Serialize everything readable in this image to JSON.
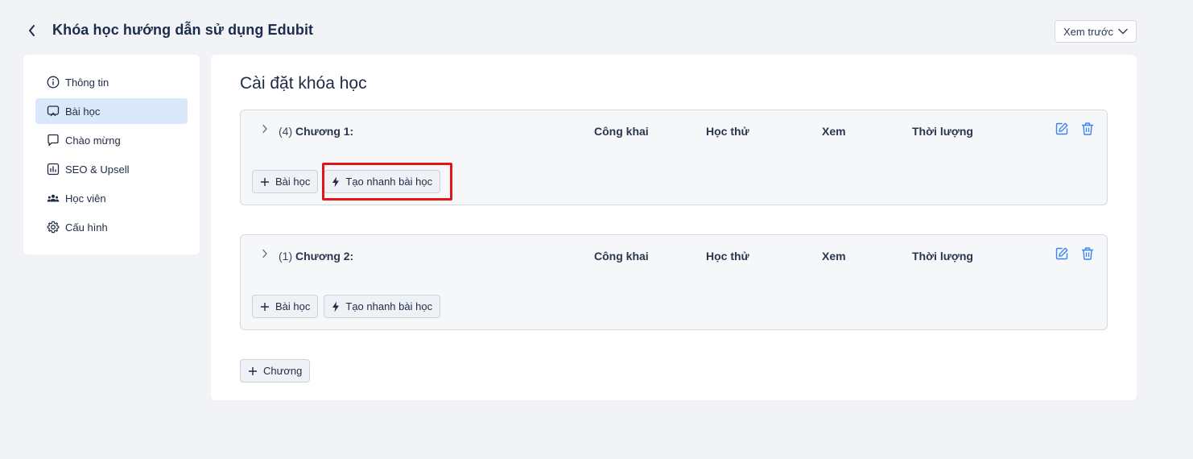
{
  "header": {
    "title": "Khóa học hướng dẫn sử dụng Edubit",
    "preview_label": "Xem trước"
  },
  "sidebar": {
    "items": [
      {
        "label": "Thông tin",
        "icon": "info-icon"
      },
      {
        "label": "Bài học",
        "icon": "lesson-icon",
        "active": true
      },
      {
        "label": "Chào mừng",
        "icon": "chat-bubble-icon"
      },
      {
        "label": "SEO & Upsell",
        "icon": "bar-chart-icon"
      },
      {
        "label": "Học viên",
        "icon": "users-icon"
      },
      {
        "label": "Cấu hình",
        "icon": "gear-icon"
      }
    ]
  },
  "main": {
    "title": "Cài đặt khóa học",
    "columns": [
      "Công khai",
      "Học thử",
      "Xem",
      "Thời lượng"
    ],
    "chapters": [
      {
        "count": "(4)",
        "name": "Chương 1:",
        "add_lesson_label": "Bài học",
        "quick_create_label": "Tạo nhanh bài học"
      },
      {
        "count": "(1)",
        "name": "Chương 2:",
        "add_lesson_label": "Bài học",
        "quick_create_label": "Tạo nhanh bài học"
      }
    ],
    "add_chapter_label": "Chương"
  },
  "colors": {
    "accent": "#3b82f6",
    "highlight": "#e0161b",
    "active_nav_bg": "#dbe7fb"
  }
}
